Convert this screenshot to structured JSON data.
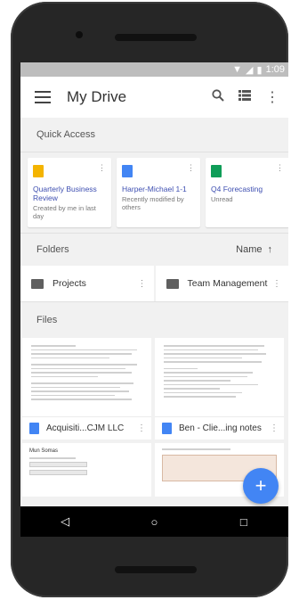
{
  "status": {
    "time": "1:09"
  },
  "appbar": {
    "title": "My Drive"
  },
  "quick_access": {
    "label": "Quick Access",
    "items": [
      {
        "name": "Quarterly Business Review",
        "sub": "Created by me in last day",
        "color": "#f4b400"
      },
      {
        "name": "Harper-Michael 1-1",
        "sub": "Recently modified by others",
        "color": "#4285f4"
      },
      {
        "name": "Q4 Forecasting",
        "sub": "Unread",
        "color": "#0f9d58"
      }
    ]
  },
  "folders": {
    "label": "Folders",
    "sort_label": "Name",
    "items": [
      {
        "name": "Projects"
      },
      {
        "name": "Team Management"
      }
    ]
  },
  "files": {
    "label": "Files",
    "items": [
      {
        "name": "Acquisiti...CJM LLC"
      },
      {
        "name": "Ben - Clie...ing notes"
      }
    ],
    "next_thumb_text": "Mun Somas"
  },
  "colors": {
    "accent": "#4285f4",
    "link": "#3e4fb1"
  }
}
